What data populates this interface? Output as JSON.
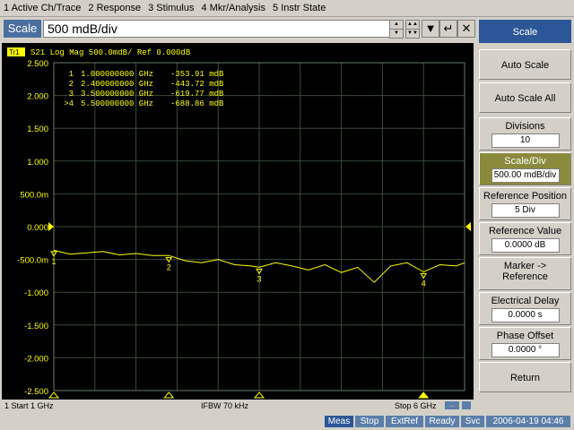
{
  "menu": [
    "1 Active Ch/Trace",
    "2 Response",
    "3 Stimulus",
    "4 Mkr/Analysis",
    "5 Instr State"
  ],
  "entry": {
    "label": "Scale",
    "value": "500 mdB/div"
  },
  "trace_header": "S21 Log Mag 500.0mdB/ Ref 0.000dB",
  "trace_tag": "Tr1",
  "marker_table": [
    {
      "id": "1",
      "freq": "1.000000000 GHz",
      "value": "-353.91 mdB"
    },
    {
      "id": "2",
      "freq": "2.400000000 GHz",
      "value": "-443.72 mdB"
    },
    {
      "id": "3",
      "freq": "3.500000000 GHz",
      "value": "-619.77 mdB"
    },
    {
      "id": ">4",
      "freq": "5.500000000 GHz",
      "value": "-688.86 mdB"
    }
  ],
  "y_ticks": [
    "2.500",
    "2.000",
    "1.500",
    "1.000",
    "500.0m",
    "0.000",
    "-500.0m",
    "-1.000",
    "-1.500",
    "-2.000",
    "-2.500"
  ],
  "chan_status": {
    "start": "1  Start 1 GHz",
    "ifbw": "IFBW 70 kHz",
    "stop": "Stop 6 GHz"
  },
  "statusbar": [
    "Meas",
    "Stop",
    "ExtRef",
    "Ready",
    "Svc",
    "2006-04-19 04:46"
  ],
  "softkeys": {
    "title": "Scale",
    "auto_scale": "Auto Scale",
    "auto_scale_all": "Auto Scale All",
    "divisions_label": "Divisions",
    "divisions_value": "10",
    "scale_div_label": "Scale/Div",
    "scale_div_value": "500.00 mdB/div",
    "ref_pos_label": "Reference Position",
    "ref_pos_value": "5 Div",
    "ref_val_label": "Reference Value",
    "ref_val_value": "0.0000 dB",
    "marker_ref_1": "Marker ->",
    "marker_ref_2": "Reference",
    "elec_delay_label": "Electrical Delay",
    "elec_delay_value": "0.0000 s",
    "phase_offset_label": "Phase Offset",
    "phase_offset_value": "0.0000 °",
    "return": "Return"
  },
  "colors": {
    "trace": "#ffff00",
    "grid": "#3a4a3a",
    "title_key": "#2c5697",
    "active_key": "#8a8a3c"
  },
  "chart_data": {
    "type": "line",
    "x_unit": "GHz",
    "y_unit": "dB",
    "xlim": [
      1,
      6
    ],
    "ylim": [
      -2.5,
      2.5
    ],
    "x": [
      1.0,
      1.2,
      1.4,
      1.6,
      1.8,
      2.0,
      2.2,
      2.4,
      2.6,
      2.8,
      3.0,
      3.2,
      3.4,
      3.5,
      3.7,
      3.9,
      4.1,
      4.3,
      4.5,
      4.7,
      4.9,
      5.1,
      5.3,
      5.5,
      5.7,
      5.9,
      6.0
    ],
    "y": [
      -0.36,
      -0.42,
      -0.4,
      -0.38,
      -0.43,
      -0.41,
      -0.44,
      -0.44,
      -0.52,
      -0.55,
      -0.5,
      -0.58,
      -0.6,
      -0.62,
      -0.55,
      -0.6,
      -0.66,
      -0.58,
      -0.7,
      -0.62,
      -0.85,
      -0.6,
      -0.55,
      -0.69,
      -0.58,
      -0.6,
      -0.55
    ],
    "markers": [
      {
        "label": "1",
        "x": 1.0,
        "y": -0.35391
      },
      {
        "label": "2",
        "x": 2.4,
        "y": -0.44372
      },
      {
        "label": "3",
        "x": 3.5,
        "y": -0.61977
      },
      {
        "label": "4",
        "x": 5.5,
        "y": -0.68886
      }
    ]
  }
}
